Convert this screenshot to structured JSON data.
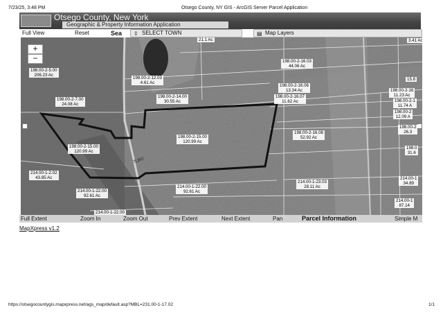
{
  "print_header": {
    "timestamp": "7/23/25, 3:48 PM",
    "title": "Otsego County, NY GIS - ArcGIS Server Parcel Application"
  },
  "banner": {
    "county": "Otsego County, New York",
    "subtitle": "Geographic & Property Information Application"
  },
  "toolbar": {
    "full_view": "Full View",
    "reset": "Reset",
    "search": "Sea",
    "select_town": "SELECT TOWN",
    "map_layers": "Map Layers"
  },
  "map": {
    "zoom_in": "+",
    "zoom_out": "−",
    "road_label": "7LBO",
    "parcels": [
      {
        "id": "21.1 Ac"
      },
      {
        "id": "3.41 Ac"
      },
      {
        "id": "198.00-2-5.00",
        "area": "206.23 Ac"
      },
      {
        "id": "198.00-2-12.03",
        "area": "4.61 Ac"
      },
      {
        "id": "198.00-2-16.03",
        "area": "44.06 Ac"
      },
      {
        "id": "198.00-2-16.06",
        "area": "13.34 Ac"
      },
      {
        "id": "198.00-2-14.00",
        "area": "30.55 Ac"
      },
      {
        "id": "198.00-2-7.00",
        "area": "24.08 Ac"
      },
      {
        "id": "198.00-2-16.07",
        "area": "11.62 Ac"
      },
      {
        "id": "198.00-2-15.00",
        "area": "120.99 Ac"
      },
      {
        "id": "198.00-2-15.00",
        "area": "120.99 Ac"
      },
      {
        "id": "198.00-2-16.08",
        "area": "52.92 Ac"
      },
      {
        "id": "214.00-1-2.02",
        "area": "43.85 Ac"
      },
      {
        "id": "214.00-1-22.00",
        "area": "92.61 Ac"
      },
      {
        "id": "214.00-1-22.00",
        "area": "92.61 Ac"
      },
      {
        "id": "214.00-1-23.03",
        "area": "28.11 Ac"
      },
      {
        "id": "214.00-1-22.00"
      },
      {
        "id": "15.8"
      },
      {
        "id": "198.00-2-16",
        "area": "11.23 Ac"
      },
      {
        "id": "198.00-2-1",
        "area": "11.74 A"
      },
      {
        "id": "198.00-2",
        "area": "12.09 A"
      },
      {
        "id": "198.00-2",
        "area": "26.3"
      },
      {
        "id": "198.0",
        "area": "31.6"
      },
      {
        "id": "214.00-1",
        "area": "34.89"
      },
      {
        "id": "214.00-1",
        "area": "87.14"
      }
    ]
  },
  "bottom_tools": {
    "full_extent": "Full Extent",
    "zoom_in": "Zoom In",
    "zoom_out": "Zoom Out",
    "prev_extent": "Prev Extent",
    "next_extent": "Next Extent",
    "pan": "Pan",
    "parcel_information": "Parcel Information",
    "simple": "Simple M"
  },
  "version": "MapXpress v1.2",
  "footer": {
    "url": "https://otsegocountygis.mapxpress.net/ags_map/default.asp?MBL=231.00-1-17.02",
    "page": "1/1"
  }
}
